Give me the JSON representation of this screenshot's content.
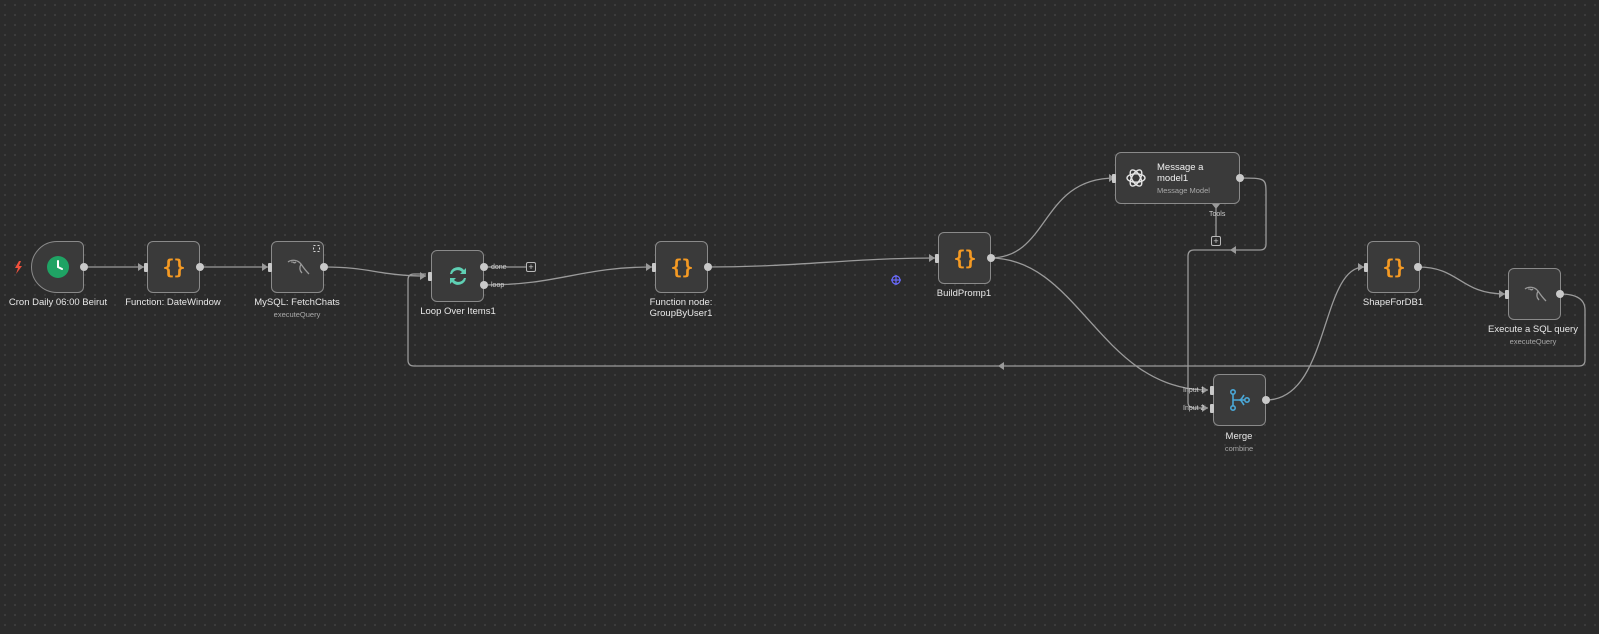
{
  "canvas": {
    "background": "#2b2b2b",
    "node_border": "#8a8a8a",
    "wire_color": "#9a9a9a"
  },
  "trigger_icon": {
    "name": "lightning-icon",
    "color": "#f0503c"
  },
  "nodes": {
    "cron": {
      "label": "Cron Daily 06:00 Beirut",
      "icon": "clock-icon",
      "color": "#1fa364"
    },
    "date_window": {
      "label": "Function: DateWindow",
      "icon": "code-braces-icon"
    },
    "fetch_chats": {
      "label": "MySQL: FetchChats",
      "sub": "executeQuery",
      "icon": "mysql-dolphin-icon"
    },
    "loop": {
      "label": "Loop Over Items1",
      "icon": "loop-arrows-icon",
      "color": "#5fd0b4",
      "out_done": "done",
      "out_loop": "loop"
    },
    "group_by_user": {
      "label_line1": "Function node:",
      "label_line2": "GroupByUser1",
      "icon": "code-braces-icon"
    },
    "build_prompt": {
      "label": "BuildPromp1",
      "icon": "code-braces-icon"
    },
    "message_model": {
      "title": "Message a model1",
      "sub": "Message Model",
      "tools_label": "Tools",
      "icon": "openai-icon"
    },
    "merge": {
      "label": "Merge",
      "sub": "combine",
      "icon": "merge-icon",
      "color": "#4aa8d8",
      "input1": "Input 1",
      "input2": "Input 2"
    },
    "shape_for_db": {
      "label": "ShapeForDB1",
      "icon": "code-braces-icon"
    },
    "exec_sql": {
      "label": "Execute a SQL query",
      "sub": "executeQuery",
      "icon": "mysql-dolphin-icon"
    }
  },
  "glyphs": {
    "braces": "{}",
    "plus": "+"
  }
}
